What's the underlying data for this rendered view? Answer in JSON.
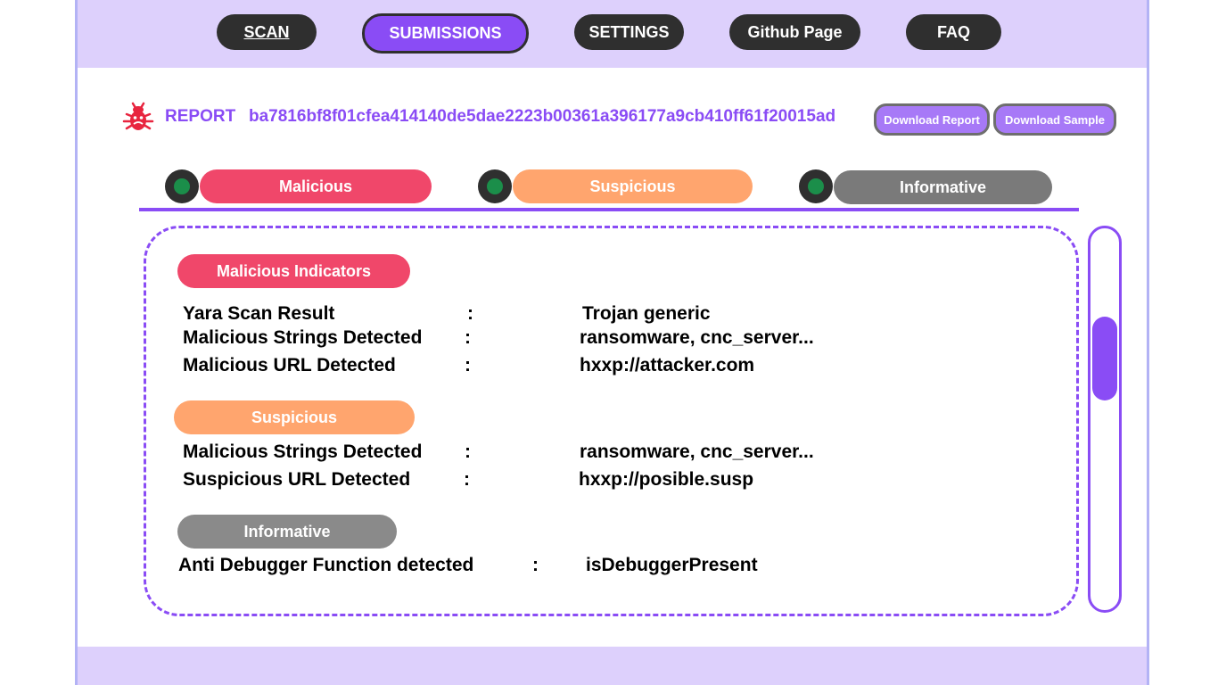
{
  "nav": {
    "scan": "SCAN",
    "submissions": "SUBMISSIONS",
    "settings": "SETTINGS",
    "github": "Github Page",
    "faq": "FAQ"
  },
  "report": {
    "label": "REPORT",
    "hash": "ba7816bf8f01cfea414140de5dae2223b00361a396177a9cb410ff61f20015ad",
    "download_report": "Download Report",
    "download_sample": "Download Sample"
  },
  "tabs": [
    {
      "label": "Malicious"
    },
    {
      "label": "Suspicious"
    },
    {
      "label": "Informative"
    }
  ],
  "sections": {
    "malicious": {
      "title": "Malicious Indicators",
      "rows": [
        {
          "key": "Yara Scan Result",
          "sep": ":",
          "value": "Trojan generic"
        },
        {
          "key": "Malicious Strings Detected",
          "sep": ":",
          "value": "ransomware, cnc_server..."
        },
        {
          "key": "Malicious URL Detected",
          "sep": ":",
          "value": "hxxp://attacker.com"
        }
      ]
    },
    "suspicious": {
      "title": "Suspicious",
      "rows": [
        {
          "key": "Malicious Strings Detected",
          "sep": ":",
          "value": "ransomware, cnc_server..."
        },
        {
          "key": "Suspicious URL Detected",
          "sep": ":",
          "value": "hxxp://posible.susp"
        }
      ]
    },
    "informative": {
      "title": "Informative",
      "rows": [
        {
          "key": "Anti Debugger Function detected",
          "sep": ":",
          "value": "isDebuggerPresent"
        }
      ]
    }
  },
  "colors": {
    "accent": "#8a4cf5",
    "malicious": "#f0476a",
    "suspicious": "#ffa56e",
    "informative": "#7a7a7a",
    "bug_icon": "#e8253f"
  },
  "icons": {
    "report": "bug-icon",
    "tab_status": "status-dot-icon"
  }
}
